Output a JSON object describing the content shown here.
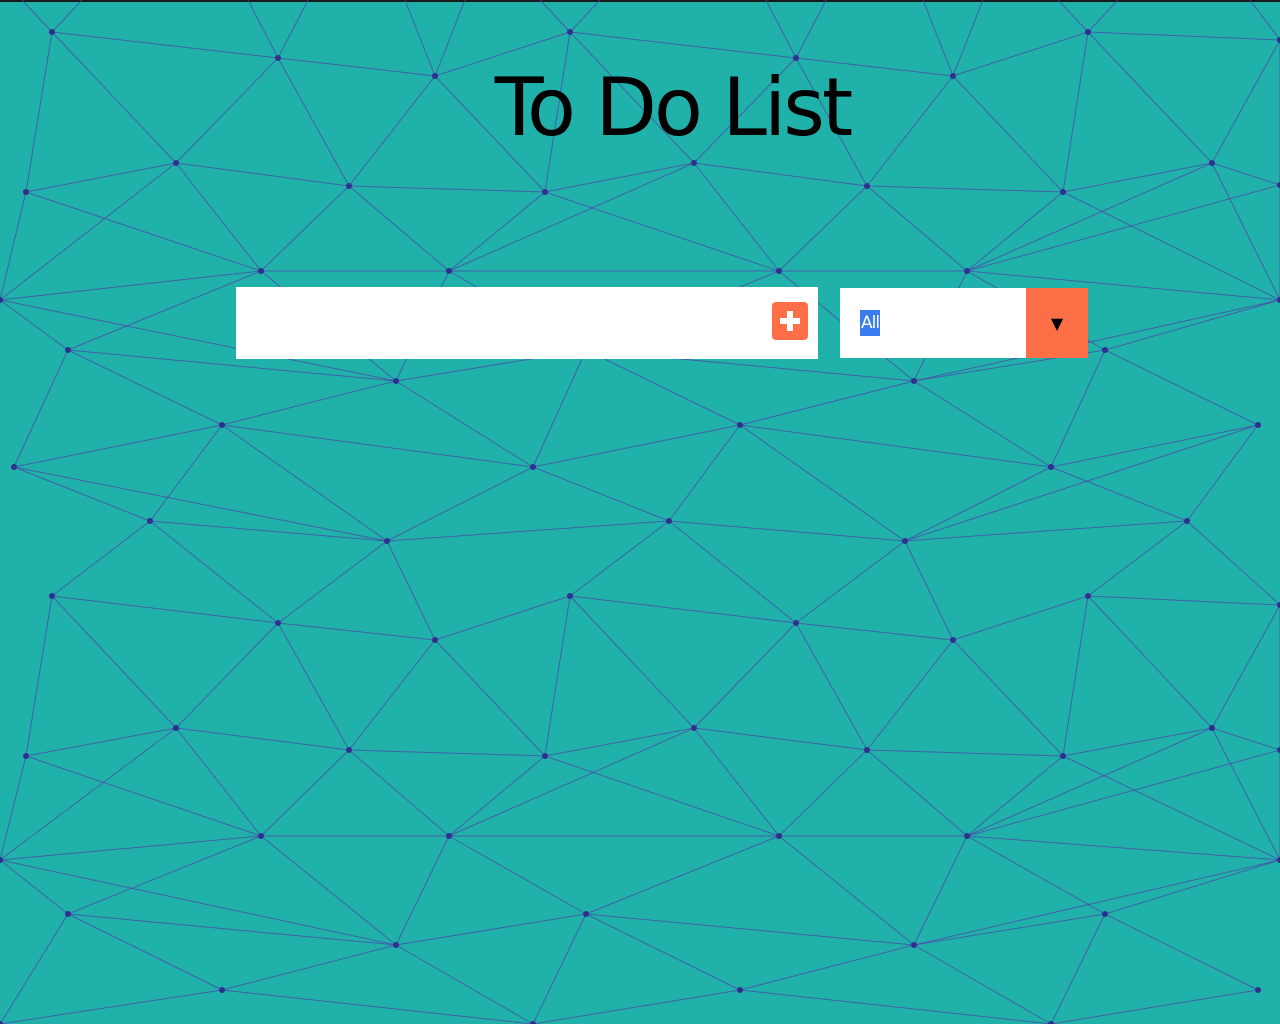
{
  "app": {
    "title": "To Do List"
  },
  "todo_input": {
    "value": "",
    "placeholder": ""
  },
  "add_button": {
    "icon": "plus-icon"
  },
  "filter": {
    "selected": "All",
    "arrow_glyph": "▼"
  },
  "colors": {
    "background": "#20b2aa",
    "accent": "#ff6f47",
    "network_lines": "#4b45a8",
    "selection": "#3b7bf0"
  }
}
